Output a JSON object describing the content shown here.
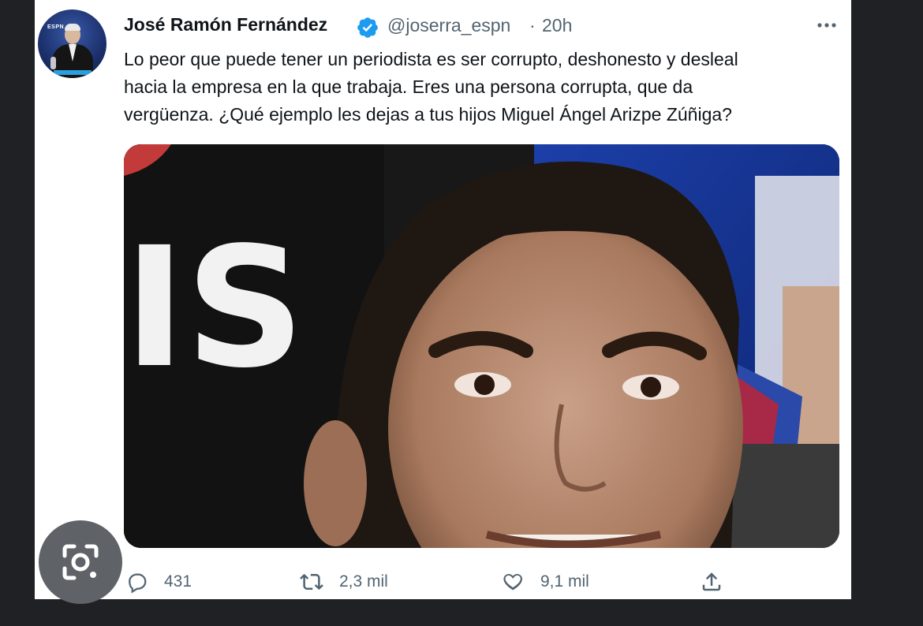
{
  "tweet": {
    "author_name": "José Ramón Fernández",
    "handle": "@joserra_espn",
    "separator": "·",
    "time": "20h",
    "text_lines": [
      "Lo peor que puede tener un periodista es ser corrupto, deshonesto y desleal",
      "hacia la empresa en la que trabaja. Eres una persona corrupta, que da",
      "vergüenza. ¿Qué ejemplo les dejas a tus hijos Miguel Ángel Arizpe Zúñiga?"
    ],
    "avatar_tag": "ESPN",
    "media_shirt_text": "IS"
  },
  "actions": {
    "replies": "431",
    "retweets": "2,3 mil",
    "likes": "9,1 mil"
  },
  "icons": {
    "verified": "verified-badge-icon",
    "more": "more-options-icon",
    "reply": "reply-icon",
    "retweet": "retweet-icon",
    "like": "heart-icon",
    "share": "share-icon",
    "lens": "google-lens-icon"
  },
  "colors": {
    "verified": "#1d9bf0",
    "text": "#0f1419",
    "muted": "#536471",
    "page_bg": "#202124",
    "lens_bg": "#5f6368"
  }
}
